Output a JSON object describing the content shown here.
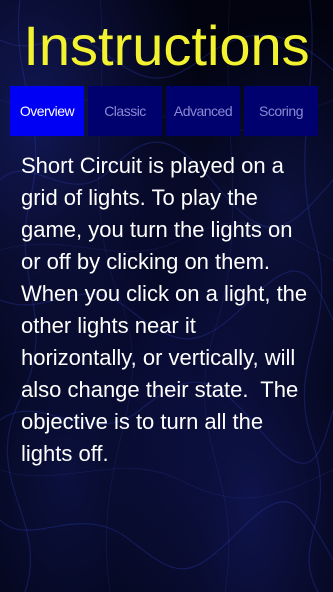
{
  "header": {
    "title": "Instructions"
  },
  "tabs": [
    {
      "label": "Overview",
      "active": true
    },
    {
      "label": "Classic",
      "active": false
    },
    {
      "label": "Advanced",
      "active": false
    },
    {
      "label": "Scoring",
      "active": false
    }
  ],
  "content": {
    "text": "Short Circuit is played on a grid of lights. To play the game, you turn the lights on or off by clicking on them. When you click on a light, the other lights near it horizontally, or vertically, will also change their state.  The objective is to turn all the lights off."
  },
  "colors": {
    "title": "#f2f230",
    "tab_active_bg": "#0000f5",
    "tab_inactive_bg": "#00006f",
    "tab_inactive_text": "#8a8ad0",
    "body_text": "#ffffff",
    "background": "#02030f"
  }
}
